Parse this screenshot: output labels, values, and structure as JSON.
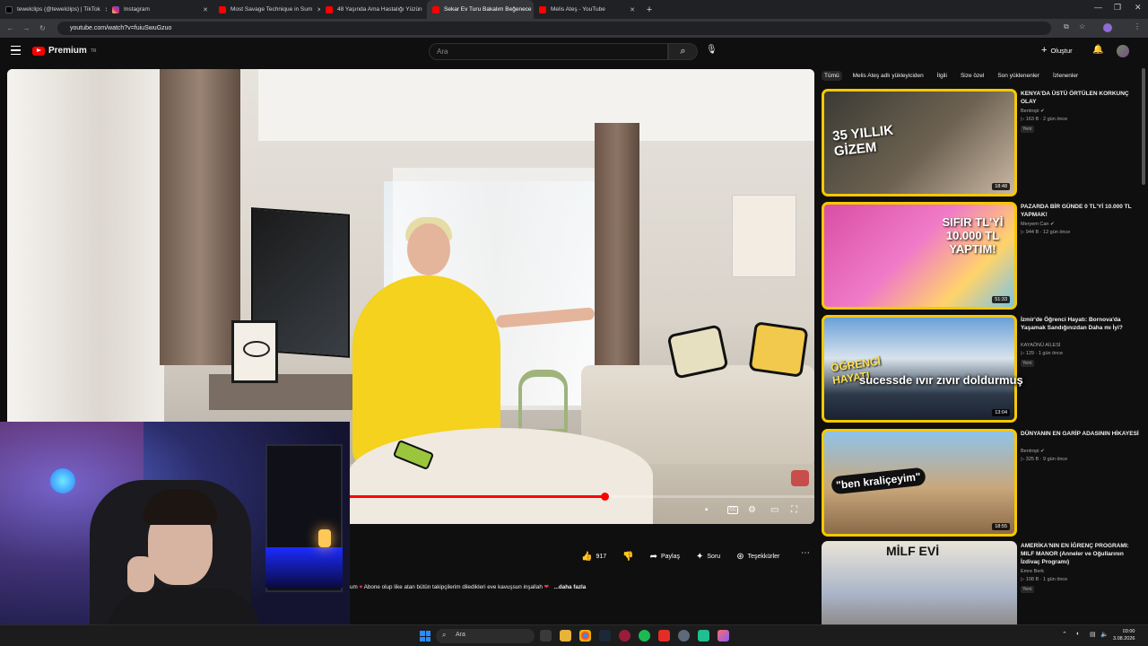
{
  "browser": {
    "tabs": [
      {
        "label": "tewelclips (@tewelclips) | TikTok",
        "favicon_color": "#000000",
        "active": false
      },
      {
        "label": "Instagram",
        "favicon_color": "#d62976",
        "active": false
      },
      {
        "label": "Most Savage Technique in Sum",
        "favicon_color": "#ff0000",
        "active": false
      },
      {
        "label": "48 Yaşında Ama Hastalığı Yüzün",
        "favicon_color": "#ff0000",
        "active": false
      },
      {
        "label": "Sekar Ev Turu Bakalım Beğenece",
        "favicon_color": "#ff0000",
        "active": true
      },
      {
        "label": "Melis Ateş - YouTube",
        "favicon_color": "#ff0000",
        "active": false
      }
    ],
    "url": "youtube.com/watch?v=fuiuSwuGzuo"
  },
  "youtube": {
    "logo_text": "Premium",
    "logo_sup": "TR",
    "search_placeholder": "Ara",
    "create_label": "Oluştur"
  },
  "player": {
    "progress_fraction": 0.55
  },
  "actions": {
    "likes": "917",
    "share": "Paylaş",
    "ask": "Soru",
    "thanks": "Teşekkürler"
  },
  "description": {
    "prefix": "um",
    "text": "Abone olup like atan bütün takipçilerim diledikleri eve kavuşsun inşallah",
    "more": "...daha fazla"
  },
  "chips": [
    "Tümü",
    "Melis Ateş adlı yükleyiciden",
    "İlgili",
    "Size özel",
    "Son yüklenenler",
    "İzlenenler"
  ],
  "recommendations": [
    {
      "title": "KENYA'DA ÜSTÜ ÖRTÜLEN KORKUNÇ OLAY",
      "channel": "Bentropi",
      "meta": "163 B · 2 gün önce",
      "badge": "Yeni",
      "duration": "18:48",
      "thumb_text": "35 YILLIK GİZEM"
    },
    {
      "title": "PAZARDA BİR GÜNDE 0 TL'Yİ 10.000 TL YAPMAK!",
      "channel": "Meryem Can",
      "meta": "944 B · 12 gün önce",
      "badge": "",
      "duration": "51:33",
      "thumb_text": "SIFIR TL'Yİ 10.000 TL YAPTIM!"
    },
    {
      "title": "İzmir'de Öğrenci Hayatı: Bornova'da Yaşamak Sandığınızdan Daha mı İyi?",
      "channel": "KAYAÖNÜ AİLESİ",
      "meta": "129 · 1 gün önce",
      "badge": "Yeni",
      "duration": "13:04",
      "thumb_text": "ÖĞRENCİ HAYATI"
    },
    {
      "title": "DÜNYANIN EN GARİP ADASININ HİKAYESİ",
      "channel": "Bentropi",
      "meta": "325 B · 9 gün önce",
      "badge": "",
      "duration": "18:55",
      "thumb_text": "\"ben kraliçeyim\""
    },
    {
      "title": "AMERİKA'NIN EN İĞRENÇ PROGRAMI: MILF MANOR (Anneler ve Oğullarının İzdivaç Programı)",
      "channel": "Emre Berk",
      "meta": "108 B · 1 gün önce",
      "badge": "Yeni",
      "duration": "",
      "thumb_text": "MİLF EVİ"
    }
  ],
  "overlay_caption": "sucessde ıvır zıvır doldurmuş",
  "taskbar": {
    "search_label": "Ara",
    "time": "03:00",
    "date": "3.08.2026"
  }
}
